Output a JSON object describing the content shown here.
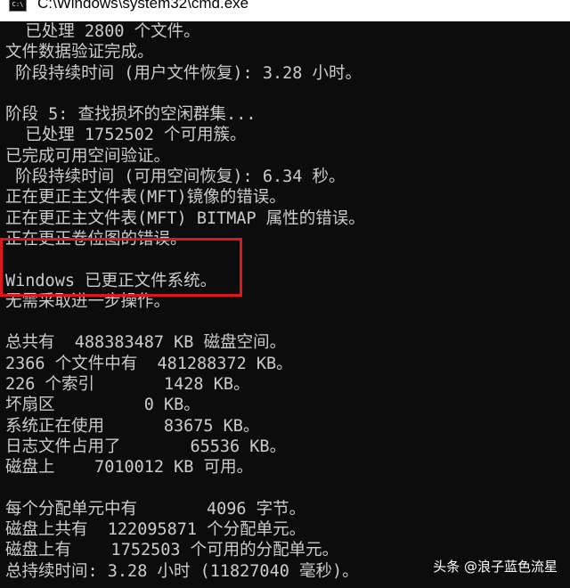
{
  "window": {
    "title": "C:\\Windows\\system32\\cmd.exe",
    "icon": "cmd-icon",
    "icon_text": "C:\\"
  },
  "console": {
    "lines": [
      "  已处理 2800 个文件。",
      "文件数据验证完成。",
      " 阶段持续时间 (用户文件恢复): 3.28 小时。",
      "",
      "阶段 5: 查找损坏的空闲群集...",
      "  已处理 1752502 个可用簇。",
      "已完成可用空间验证。",
      " 阶段持续时间 (可用空间恢复): 6.34 秒。",
      "正在更正主文件表(MFT)镜像的错误。",
      "正在更正主文件表(MFT) BITMAP 属性的错误。",
      "正在更正卷位图的错误。",
      "",
      "Windows 已更正文件系统。",
      "无需采取进一步操作。",
      "",
      "总共有  488383487 KB 磁盘空间。",
      "2366 个文件中有  481288372 KB。",
      "226 个索引       1428 KB。",
      "坏扇区         0 KB。",
      "系统正在使用      83675 KB。",
      "日志文件占用了       65536 KB。",
      "磁盘上    7010012 KB 可用。",
      "",
      "每个分配单元中有       4096 字节。",
      "磁盘上共有  122095871 个分配单元。",
      "磁盘上有    1752503 个可用的分配单元。",
      "总持续时间: 3.28 小时 (11827040 毫秒)。"
    ]
  },
  "watermark": "头条 @浪子蓝色流星",
  "colors": {
    "console_bg": "#0c0c0c",
    "console_text": "#cccccc",
    "highlight": "#e0161c"
  }
}
